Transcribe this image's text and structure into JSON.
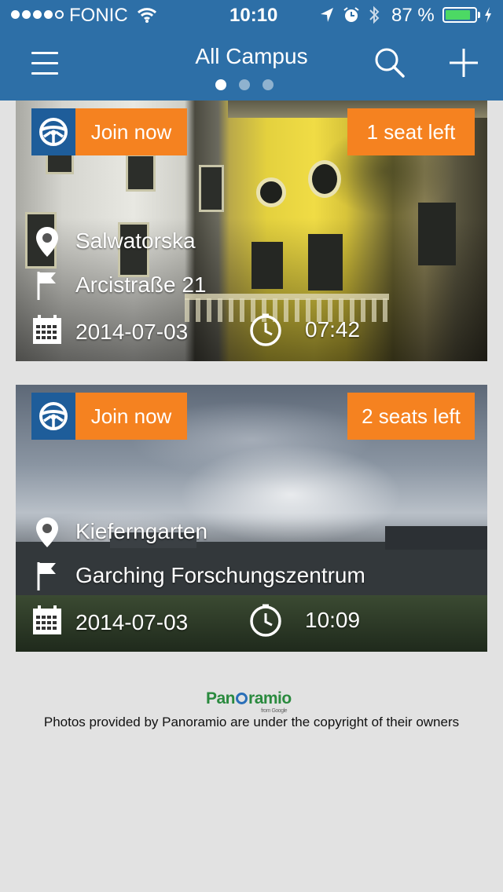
{
  "status_bar": {
    "carrier": "FONIC",
    "time": "10:10",
    "battery_percent": "87 %",
    "battery_level": 0.87,
    "signal_dots_filled": 4,
    "signal_dots_total": 5,
    "icons": [
      "wifi-icon",
      "location-arrow-icon",
      "alarm-icon",
      "bluetooth-icon",
      "battery-icon",
      "charging-icon"
    ]
  },
  "navbar": {
    "title": "All Campus",
    "page_dots": {
      "count": 3,
      "active_index": 0
    },
    "icons": [
      "menu-icon",
      "search-icon",
      "plus-icon"
    ]
  },
  "rides": [
    {
      "join_label": "Join now",
      "seats_label": "1 seat left",
      "from": "Salwatorska",
      "to": "Arcistraße 21",
      "date": "2014-07-03",
      "time": "07:42"
    },
    {
      "join_label": "Join now",
      "seats_label": "2 seats left",
      "from": "Kieferngarten",
      "to": "Garching Forschungszentrum",
      "date": "2014-07-03",
      "time": "10:09"
    }
  ],
  "footer": {
    "logo_text": "Panoramio",
    "logo_sub": "from Google",
    "credit": "Photos provided by Panoramio are under the copyright of their owners"
  },
  "colors": {
    "nav_blue": "#2d6fa7",
    "join_orange": "#f58220",
    "wheel_blue": "#1e5d9a",
    "background": "#e2e2e2",
    "battery_green": "#4cd964"
  }
}
